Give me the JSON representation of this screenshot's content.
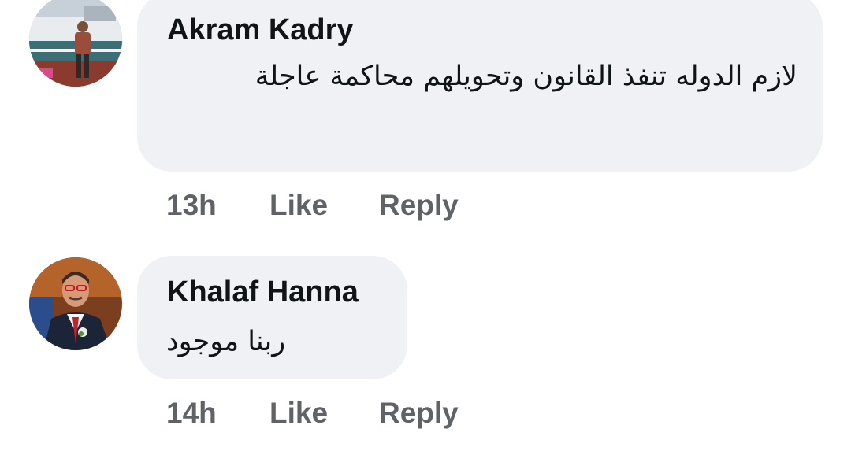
{
  "comments": [
    {
      "author": "Akram Kadry",
      "text": "لازم الدوله تنفذ القانون وتحويلهم محاكمة عاجلة",
      "time": "13h",
      "like_label": "Like",
      "reply_label": "Reply"
    },
    {
      "author": "Khalaf Hanna",
      "text": "ربنا موجود",
      "time": "14h",
      "like_label": "Like",
      "reply_label": "Reply"
    }
  ],
  "colors": {
    "bubble_bg": "#eff1f5",
    "text": "#111417",
    "muted": "#5f6368"
  }
}
